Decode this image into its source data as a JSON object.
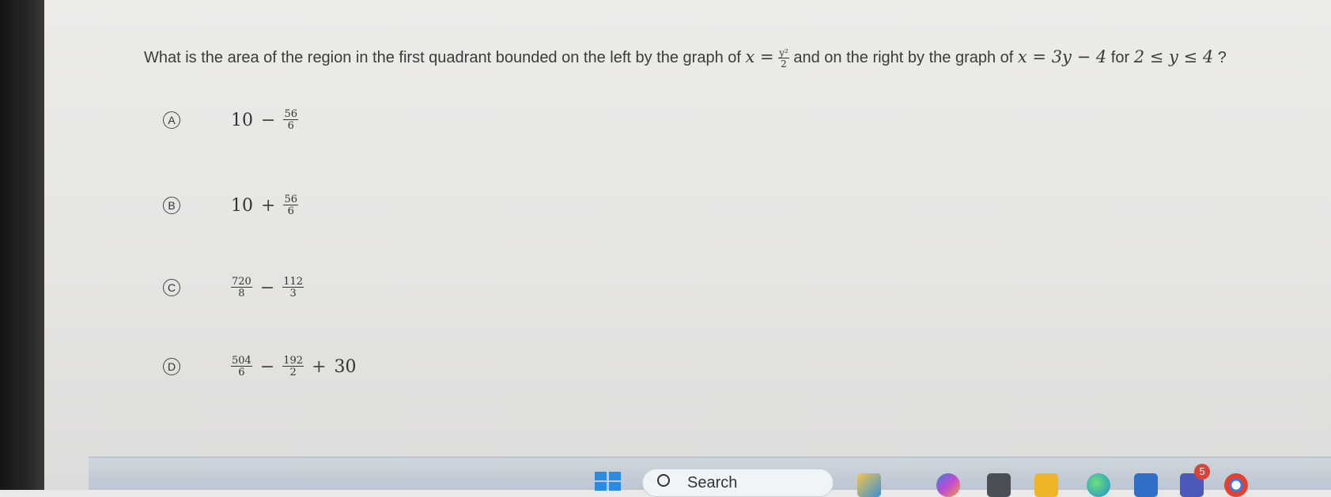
{
  "question": {
    "prefix": "What is the area of the region in the first quadrant bounded on the left by the graph of",
    "eq1_lhs": "x =",
    "eq1_num": "y²",
    "eq1_den": "2",
    "middle": "and on the right by the graph of",
    "eq2": "x = 3y − 4",
    "for_text": "for",
    "range": "2 ≤ y ≤ 4",
    "suffix": "?"
  },
  "choices": [
    {
      "letter": "A",
      "a": "10",
      "op1": "−",
      "num1": "56",
      "den1": "6"
    },
    {
      "letter": "B",
      "a": "10",
      "op1": "+",
      "num1": "56",
      "den1": "6"
    },
    {
      "letter": "C",
      "num0": "720",
      "den0": "8",
      "op1": "−",
      "num1": "112",
      "den1": "3"
    },
    {
      "letter": "D",
      "num0": "504",
      "den0": "6",
      "op1": "−",
      "num1": "192",
      "den1": "2",
      "op2": "+",
      "tail": "30"
    }
  ],
  "taskbar": {
    "search_label": "Search",
    "badge_count": "5"
  }
}
